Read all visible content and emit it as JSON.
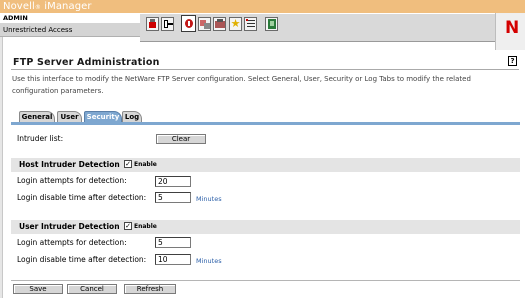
{
  "header": {
    "app_title": "Novell",
    "app_title_reg": "®",
    "app_title_product": " iManager",
    "user": "ADMIN",
    "access_mode": "Unrestricted Access",
    "brand_letter": "N",
    "toolbar_icons": [
      "home-icon",
      "exit-icon",
      "roles-tasks-icon",
      "view-objects-icon",
      "configure-icon",
      "favorites-icon",
      "preferences-icon",
      "help-book-icon"
    ]
  },
  "page": {
    "title": "FTP Server Administration",
    "help_label": "?",
    "intro": "Use this interface to modify the NetWare FTP Server configuration. Select General, User, Security or Log Tabs to modify the related configuration parameters."
  },
  "tabs": [
    {
      "label": "General",
      "active": false
    },
    {
      "label": "User",
      "active": false
    },
    {
      "label": "Security",
      "active": true
    },
    {
      "label": "Log",
      "active": false
    }
  ],
  "intruder": {
    "label": "Intruder list:",
    "clear_label": "Clear"
  },
  "host_detection": {
    "title": "Host Intruder Detection",
    "enable_label": "Enable",
    "enabled": true,
    "attempts_label": "Login attempts for detection:",
    "attempts_value": "20",
    "disable_label": "Login disable time after detection:",
    "disable_value": "5",
    "unit": "Minutes"
  },
  "user_detection": {
    "title": "User Intruder Detection",
    "enable_label": "Enable",
    "enabled": true,
    "attempts_label": "Login attempts for detection:",
    "attempts_value": "5",
    "disable_label": "Login disable time after detection:",
    "disable_value": "10",
    "unit": "Minutes"
  },
  "footer": {
    "save_label": "Save",
    "cancel_label": "Cancel",
    "refresh_label": "Refresh"
  },
  "colors": {
    "header_orange": "#f0be7e",
    "tab_active": "#7ea7d0",
    "brand_red": "#d40000",
    "unit_blue": "#2b5fa8"
  }
}
